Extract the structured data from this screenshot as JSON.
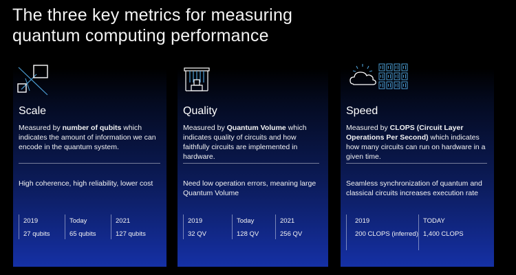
{
  "title": {
    "line1": "The three key metrics for measuring",
    "line2": "quantum computing performance"
  },
  "cards": [
    {
      "icon": "qubit-scale-icon",
      "heading": "Scale",
      "desc_pre": "Measured by ",
      "desc_bold": "number of qubits",
      "desc_post": " which indicates the amount of information we can encode in the quantum system.",
      "note": "High coherence, high reliability, lower cost",
      "stats": [
        {
          "year": "2019",
          "value": "27 qubits"
        },
        {
          "year": "Today",
          "value": "65 qubits"
        },
        {
          "year": "2021",
          "value": "127 qubits"
        }
      ]
    },
    {
      "icon": "quantum-chip-icon",
      "heading": "Quality",
      "desc_pre": "Measured by ",
      "desc_bold": "Quantum Volume",
      "desc_post": " which indicates quality of circuits and how faithfully circuits are implemented in hardware.",
      "note": "Need low operation errors, meaning large Quantum Volume",
      "stats": [
        {
          "year": "2019",
          "value": "32 QV"
        },
        {
          "year": "Today",
          "value": "128 QV"
        },
        {
          "year": "2021",
          "value": "256 QV"
        }
      ]
    },
    {
      "icon": "cloud-circuits-icon",
      "heading": "Speed",
      "desc_pre": "Measured by ",
      "desc_bold": "CLOPS (Circuit Layer Operations Per Second)",
      "desc_post": " which indicates how many circuits can run on hardware in a given time.",
      "note": "Seamless synchronization of quantum and classical circuits increases execution rate",
      "stats": [
        {
          "year": "2019",
          "value": "200 CLOPS (inferred)"
        },
        {
          "year": "TODAY",
          "value": "1,400 CLOPS"
        }
      ]
    }
  ],
  "colors": {
    "background": "#000000",
    "card_gradient_top": "#000000",
    "card_gradient_bottom": "#1530a5",
    "text": "#f4f4f4",
    "icon_accent": "#4d9fd6"
  }
}
